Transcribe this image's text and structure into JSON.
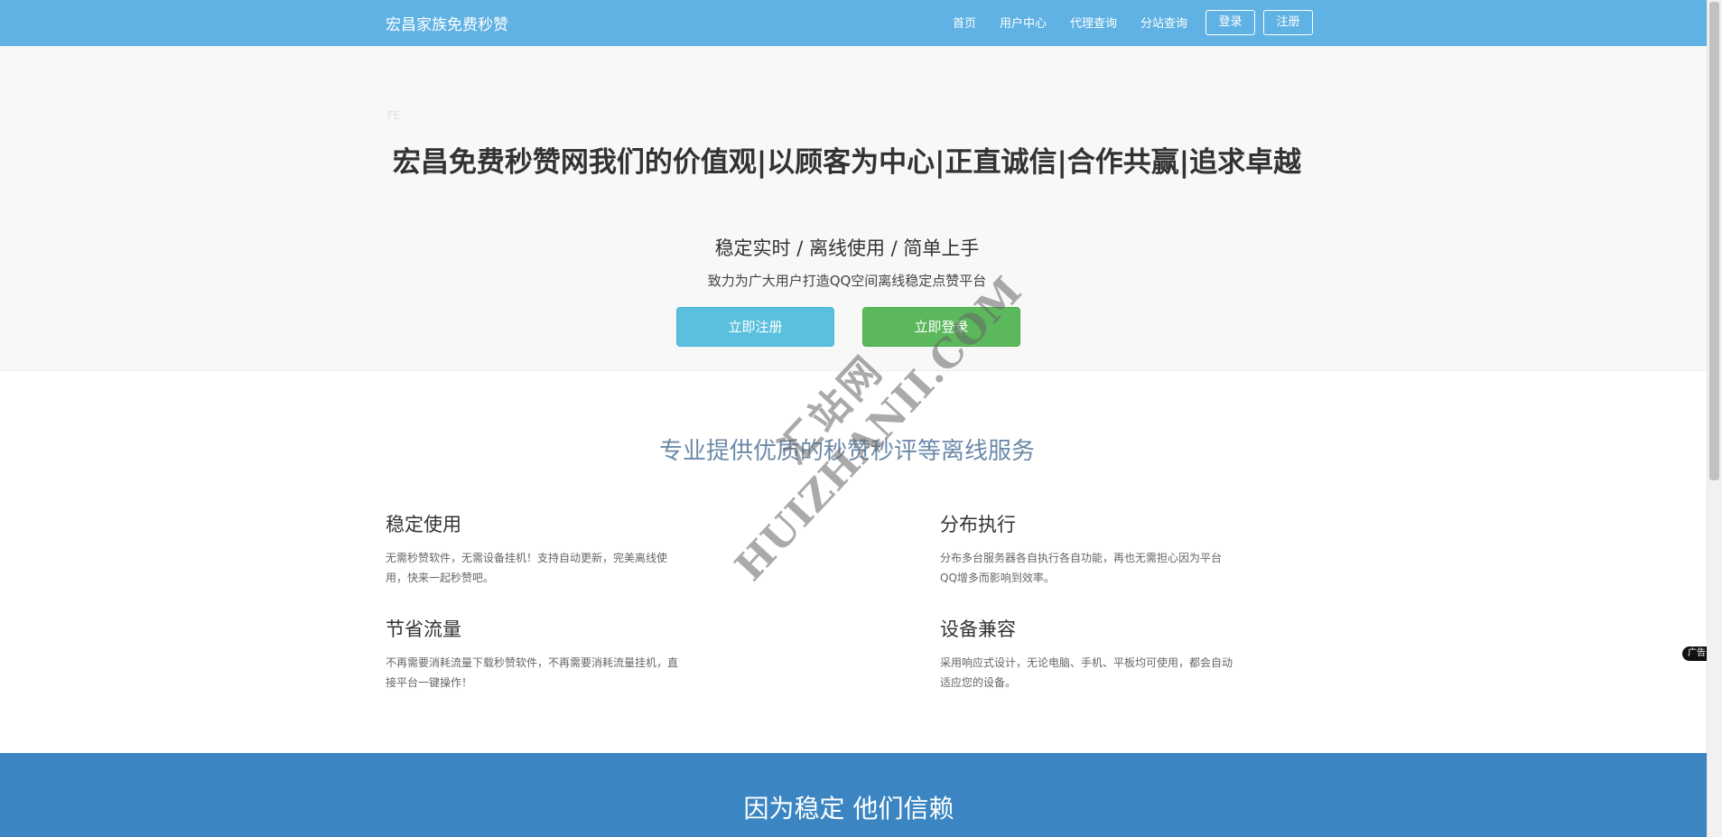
{
  "navbar": {
    "brand": "宏昌家族免费秒赞",
    "links": [
      "首页",
      "用户中心",
      "代理查询",
      "分站查询"
    ],
    "login_label": "登录",
    "register_label": "注册"
  },
  "hero": {
    "corner_mark": "FE",
    "title": "宏昌免费秒赞网我们的价值观|以顾客为中心|正直诚信|合作共赢|追求卓越",
    "subtitle": "稳定实时 / 离线使用 / 简单上手",
    "description": "致力为广大用户打造QQ空间离线稳定点赞平台",
    "register_button": "立即注册",
    "login_button": "立即登录"
  },
  "services": {
    "title": "专业提供优质的秒赞秒评等离线服务",
    "features": [
      {
        "title": "稳定使用",
        "desc": "无需秒赞软件，无需设备挂机！支持自动更新，完美离线使用，快来一起秒赞吧。"
      },
      {
        "title": "分布执行",
        "desc": "分布多台服务器各自执行各自功能，再也无需担心因为平台QQ增多而影响到效率。"
      },
      {
        "title": "节省流量",
        "desc": "不再需要消耗流量下载秒赞软件，不再需要消耗流量挂机，直接平台一键操作！"
      },
      {
        "title": "设备兼容",
        "desc": "采用响应式设计，无论电脑、手机、平板均可使用，都会自动适应您的设备。"
      }
    ]
  },
  "trust": {
    "title": "因为稳定 他们信赖"
  },
  "ad_badge": "广告",
  "watermark": {
    "cn": "汇站网",
    "en": "HUIZHANII.COM"
  },
  "colors": {
    "navbar": "#5fb2e3",
    "register_btn": "#5bc0de",
    "login_btn": "#5cb85c",
    "trust_section": "#3b86c2"
  }
}
